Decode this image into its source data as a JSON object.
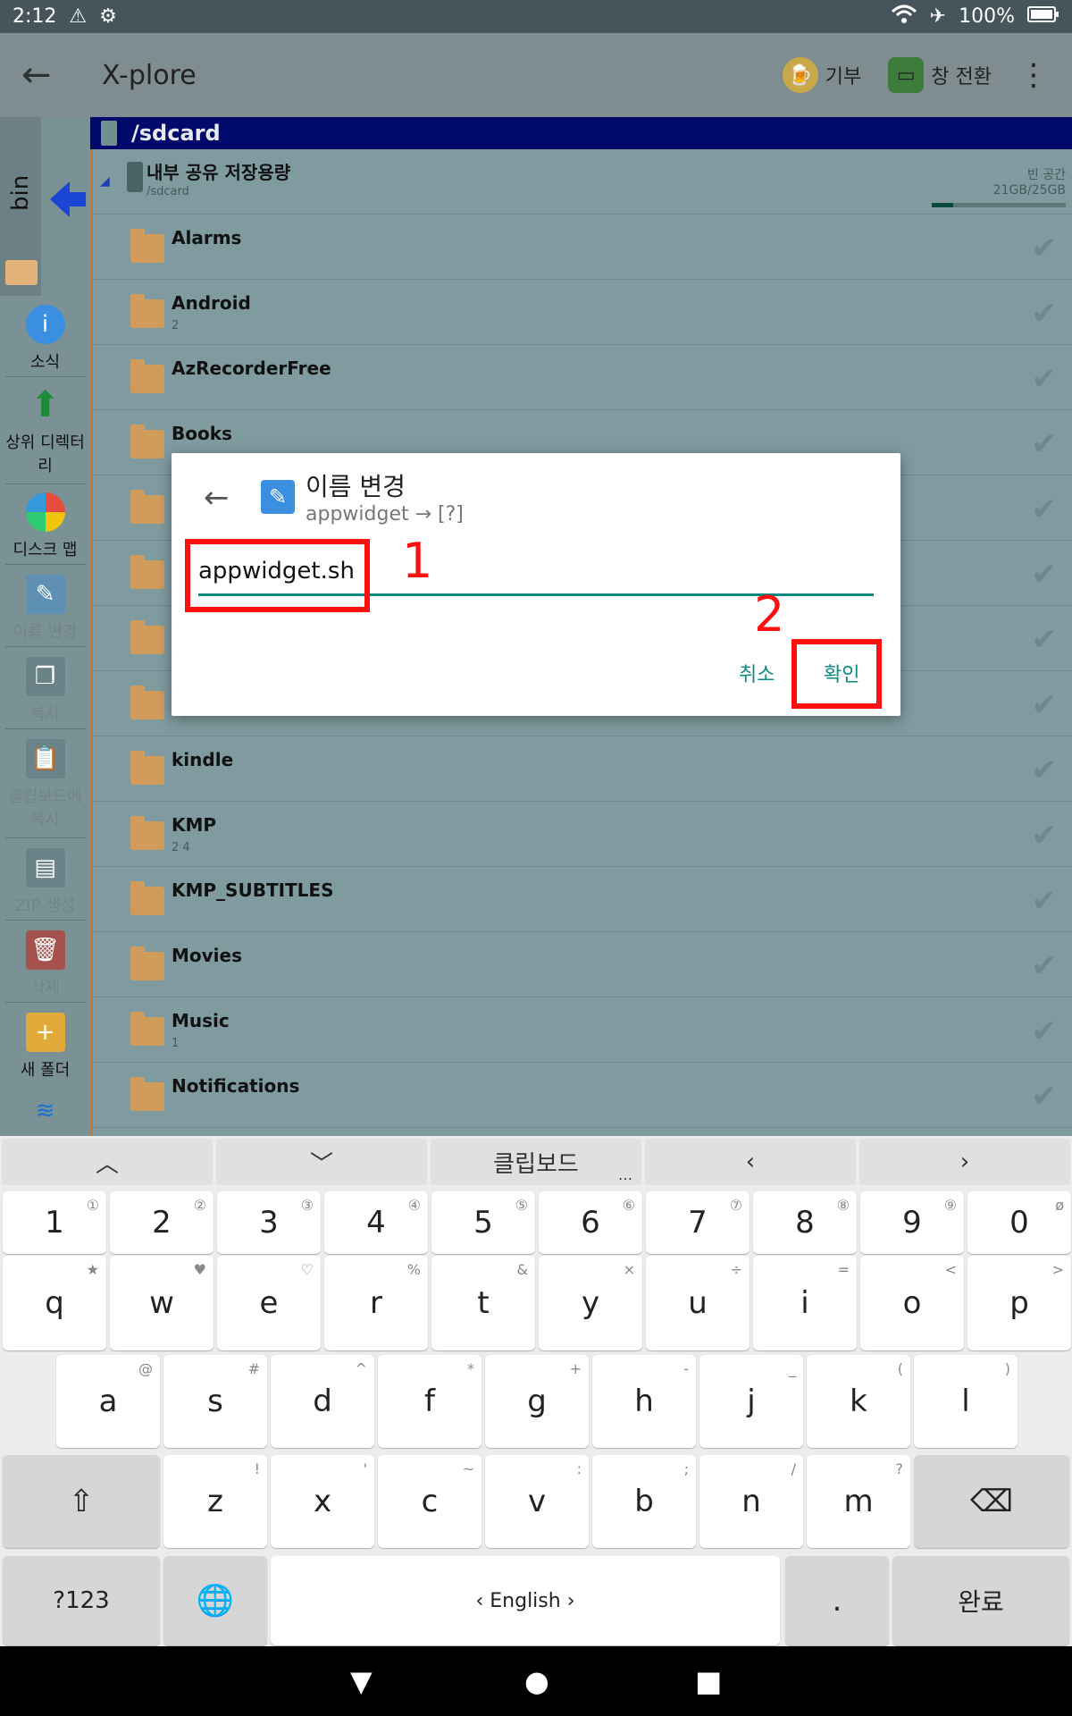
{
  "status": {
    "time": "2:12",
    "battery": "100%"
  },
  "appbar": {
    "title": "X-plore",
    "donate": "기부",
    "switch_window": "창 전환"
  },
  "sidebar": {
    "bin_label": "bin",
    "items": [
      "소식",
      "상위 디렉터리",
      "디스크 맵",
      "이름 변경",
      "복사",
      "클립보드에 복사",
      "ZIP 생성",
      "삭제",
      "새 폴더"
    ]
  },
  "pathbar": {
    "path": "/sdcard"
  },
  "storage": {
    "name": "내부 공유 저장용량",
    "path": "/sdcard",
    "free_label": "빈 공간",
    "free_value": "21GB/25GB",
    "used_fraction": 0.16
  },
  "files": [
    {
      "name": "Alarms",
      "sub": ""
    },
    {
      "name": "Android",
      "sub": "2"
    },
    {
      "name": "AzRecorderFree",
      "sub": ""
    },
    {
      "name": "Books",
      "sub": ""
    },
    {
      "name": "",
      "sub": ""
    },
    {
      "name": "",
      "sub": ""
    },
    {
      "name": "",
      "sub": ""
    },
    {
      "name": "",
      "sub": ""
    },
    {
      "name": "kindle",
      "sub": ""
    },
    {
      "name": "KMP",
      "sub": "2     4"
    },
    {
      "name": "KMP_SUBTITLES",
      "sub": ""
    },
    {
      "name": "Movies",
      "sub": ""
    },
    {
      "name": "Music",
      "sub": "1"
    },
    {
      "name": "Notifications",
      "sub": ""
    }
  ],
  "dialog": {
    "title": "이름 변경",
    "subtitle": "appwidget → [?]",
    "input_value": "appwidget.sh",
    "cancel": "취소",
    "ok": "확인"
  },
  "annotations": {
    "one": "1",
    "two": "2"
  },
  "keyboard": {
    "clipboard": "클립보드",
    "numbers": [
      "1",
      "2",
      "3",
      "4",
      "5",
      "6",
      "7",
      "8",
      "9",
      "0"
    ],
    "number_alts": [
      "①",
      "②",
      "③",
      "④",
      "⑤",
      "⑥",
      "⑦",
      "⑧",
      "⑨",
      "ø"
    ],
    "row1": [
      "q",
      "w",
      "e",
      "r",
      "t",
      "y",
      "u",
      "i",
      "o",
      "p"
    ],
    "row1_alts": [
      "★",
      "♥",
      "♡",
      "%",
      "&",
      "×",
      "÷",
      "=",
      "<",
      ">"
    ],
    "row2": [
      "a",
      "s",
      "d",
      "f",
      "g",
      "h",
      "j",
      "k",
      "l"
    ],
    "row2_alts": [
      "@",
      "#",
      "^",
      "*",
      "+",
      "-",
      "_",
      "(",
      ")"
    ],
    "row3": [
      "z",
      "x",
      "c",
      "v",
      "b",
      "n",
      "m"
    ],
    "row3_alts": [
      "!",
      "'",
      "~",
      ":",
      ";",
      "/",
      "?"
    ],
    "sym": "?123",
    "space": "English",
    "period": ".",
    "done": "완료"
  }
}
